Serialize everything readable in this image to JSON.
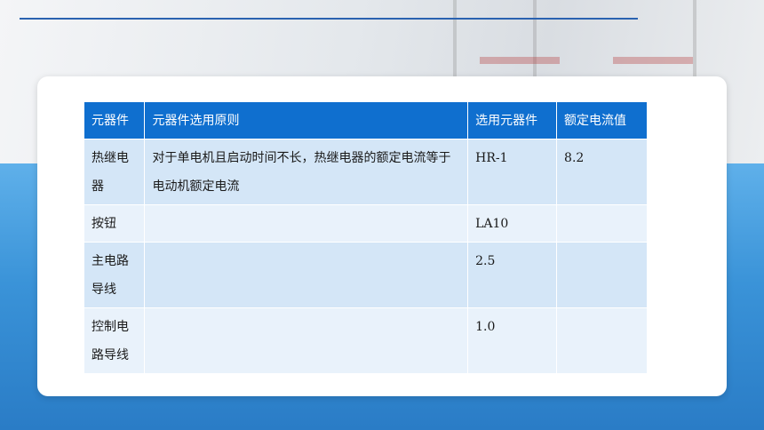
{
  "table": {
    "headers": [
      "元器件",
      "元器件选用原则",
      "选用元器件",
      "额定电流值"
    ],
    "rows": [
      [
        "热继电器",
        "对于单电机且启动时间不长，热继电器的额定电流等于电动机额定电流",
        "HR-1",
        "8.2"
      ],
      [
        "按钮",
        "",
        "LA10",
        ""
      ],
      [
        "主电路导线",
        "",
        "2.5",
        ""
      ],
      [
        "控制电路导线",
        "",
        "1.0",
        ""
      ]
    ]
  },
  "colors": {
    "header_bg": "#0f6fcf",
    "row_odd": "#d4e6f7",
    "row_even": "#e9f2fb"
  }
}
